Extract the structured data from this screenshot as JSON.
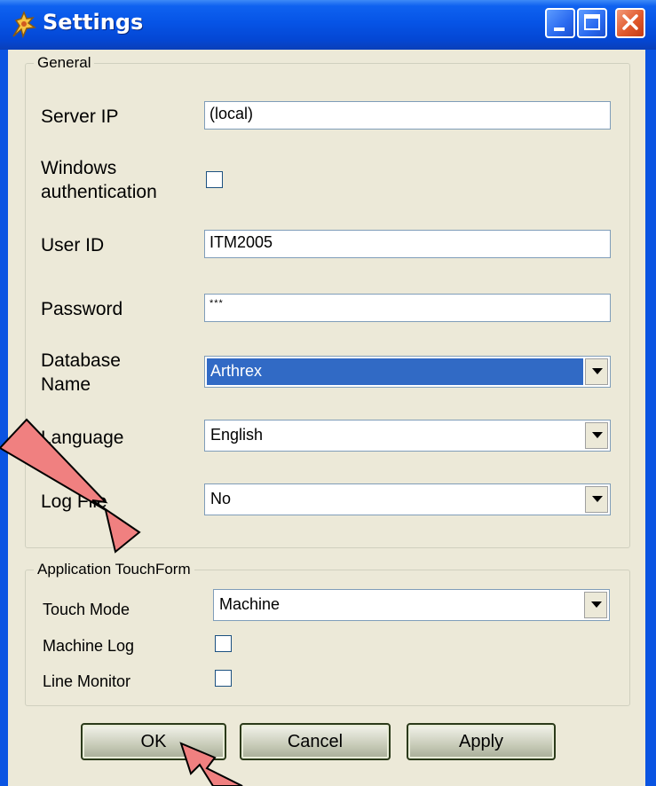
{
  "window": {
    "title": "Settings"
  },
  "general": {
    "legend": "General",
    "server_ip": {
      "label": "Server IP",
      "value": "(local)"
    },
    "windows_auth": {
      "label_line1": "Windows",
      "label_line2": "authentication",
      "checked": false
    },
    "user_id": {
      "label": "User ID",
      "value": "ITM2005"
    },
    "password": {
      "label": "Password",
      "value": "***"
    },
    "database_name": {
      "label_line1": "Database",
      "label_line2": "Name",
      "value": "Arthrex"
    },
    "language": {
      "label": "Language",
      "value": "English"
    },
    "log_file": {
      "label": "Log File",
      "value": "No"
    }
  },
  "touchform": {
    "legend": "Application TouchForm",
    "touch_mode": {
      "label": "Touch Mode",
      "value": "Machine"
    },
    "machine_log": {
      "label": "Machine Log",
      "checked": false
    },
    "line_monitor": {
      "label": "Line Monitor",
      "checked": false
    }
  },
  "buttons": {
    "ok": "OK",
    "cancel": "Cancel",
    "apply": "Apply"
  },
  "colors": {
    "annotation_arrow": "#f08080",
    "selection": "#316ac5",
    "titlebar": "#0654e6"
  }
}
